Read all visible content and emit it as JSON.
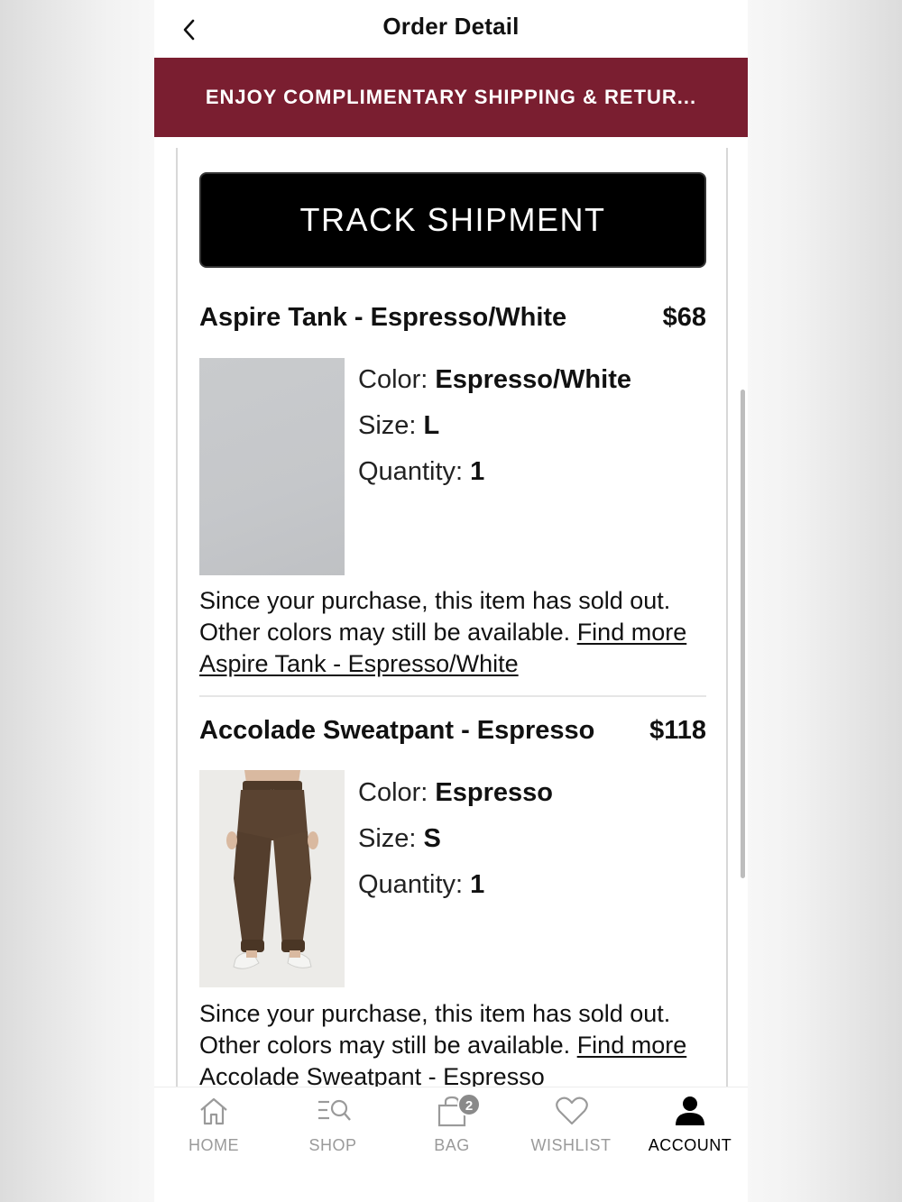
{
  "header": {
    "title": "Order Detail"
  },
  "promo": {
    "text": "ENJOY COMPLIMENTARY SHIPPING & RETUR..."
  },
  "track_button": {
    "label": "TRACK SHIPMENT"
  },
  "items": [
    {
      "name": "Aspire Tank - Espresso/White",
      "price": "$68",
      "color_label": "Color:",
      "color": "Espresso/White",
      "size_label": "Size:",
      "size": "L",
      "quantity_label": "Quantity:",
      "quantity": "1",
      "note_text": "Since your purchase, this item has sold out. Other colors may still be available.",
      "link_text": "Find more Aspire Tank - Espresso/White"
    },
    {
      "name": "Accolade Sweatpant - Espresso",
      "price": "$118",
      "color_label": "Color:",
      "color": "Espresso",
      "size_label": "Size:",
      "size": "S",
      "quantity_label": "Quantity:",
      "quantity": "1",
      "note_text": "Since your purchase, this item has sold out. Other colors may still be available.",
      "link_text": "Find more Accolade Sweatpant - Espresso"
    }
  ],
  "tabbar": {
    "tabs": [
      {
        "label": "HOME",
        "icon": "home-icon"
      },
      {
        "label": "SHOP",
        "icon": "shop-search-icon"
      },
      {
        "label": "BAG",
        "icon": "bag-icon",
        "badge": "2"
      },
      {
        "label": "WISHLIST",
        "icon": "heart-icon"
      },
      {
        "label": "ACCOUNT",
        "icon": "account-icon",
        "active": true
      }
    ]
  },
  "colors": {
    "promo_bg": "#7a1e30",
    "button_bg": "#000000",
    "active_tab": "#000000",
    "inactive_tab": "#9a9a9a"
  }
}
